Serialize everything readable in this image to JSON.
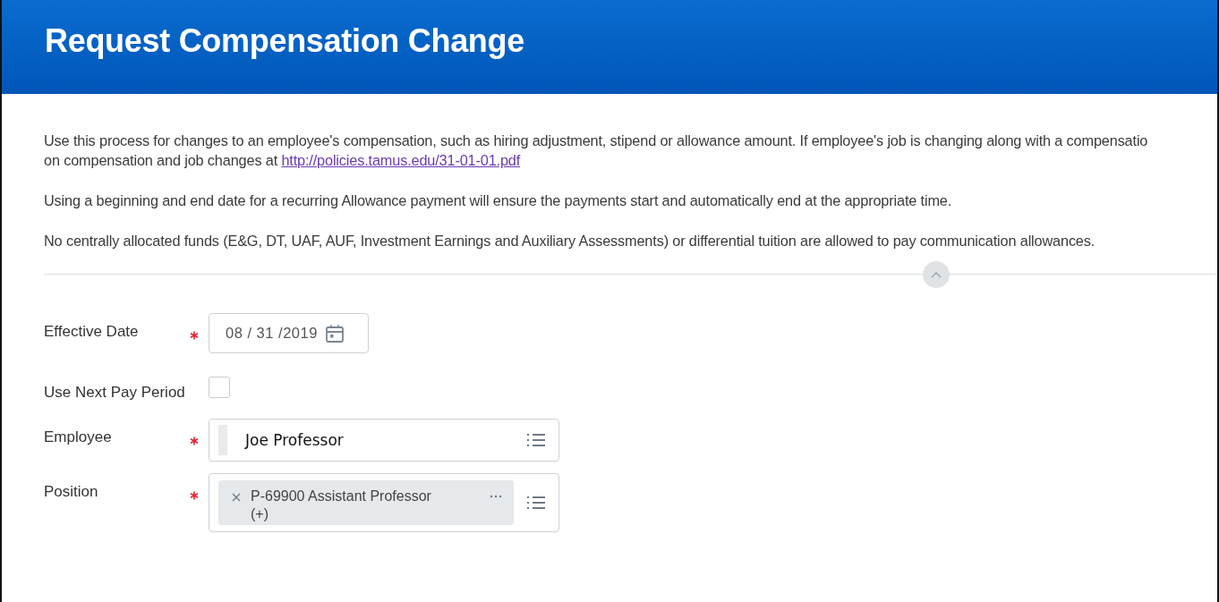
{
  "header": {
    "title": "Request Compensation Change"
  },
  "intro": {
    "line_1": "Use this process for changes to an employee's compensation, such as hiring adjustment, stipend or allowance amount. If employee's job is changing along with a compensatio",
    "line_2": "on compensation and job changes at ",
    "link": "http://policies.tamus.edu/31-01-01.pdf"
  },
  "notes": [
    "Using a beginning and end date for a recurring Allowance payment will ensure the payments start and automatically end at the appropriate time.",
    "No centrally allocated funds (E&G, DT, UAF, AUF, Investment Earnings and Auxiliary Assessments) or differential tuition are allowed to pay communication allowances."
  ],
  "fields": [
    {
      "kind": "date",
      "label": "Effective Date",
      "required": true,
      "value": "08 / 31 /2019"
    },
    {
      "kind": "checkbox",
      "label": "Use Next Pay Period",
      "required": false,
      "checked": false
    },
    {
      "kind": "prompt",
      "label": "Employee",
      "required": true,
      "value": "Joe Professor"
    },
    {
      "kind": "chip",
      "label": "Position",
      "required": true,
      "value": "P-69900 Assistant Professor",
      "value_2": "(+)"
    }
  ]
}
